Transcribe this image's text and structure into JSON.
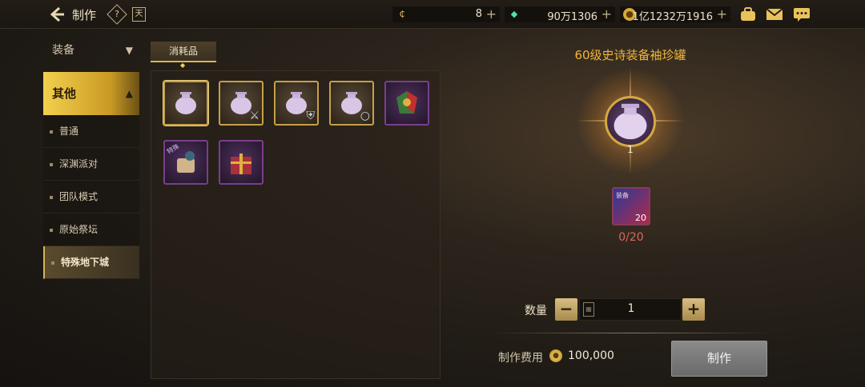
{
  "header": {
    "title": "制作",
    "help_label": "?",
    "calendar_label": "天",
    "currencies": [
      {
        "icon": "coin-c-icon",
        "value": "8"
      },
      {
        "icon": "gem-icon",
        "value": "90万1306"
      },
      {
        "icon": "gold-coin-icon",
        "value": "1亿1232万1916"
      }
    ]
  },
  "sidebar": {
    "category": "装备",
    "active": "其他",
    "items": [
      {
        "label": "普通"
      },
      {
        "label": "深渊派对"
      },
      {
        "label": "团队模式"
      },
      {
        "label": "原始祭坛"
      },
      {
        "label": "特殊地下城"
      }
    ]
  },
  "tabs": {
    "active": "消耗品"
  },
  "slot_tag": "特殊",
  "detail": {
    "item_name": "60级史诗装备袖珍罐",
    "output_count": "1",
    "material_tag": "装备",
    "material_stack": "20",
    "material_progress": "0/20",
    "quantity_label": "数量",
    "quantity_value": "1",
    "minus": "−",
    "plus": "+",
    "cost_label": "制作费用",
    "cost_value": "100,000",
    "make_button": "制作"
  },
  "colors": {
    "accent": "#f0b53a",
    "active_tab": "#f3d04e",
    "progress_red": "#d86a5a"
  }
}
